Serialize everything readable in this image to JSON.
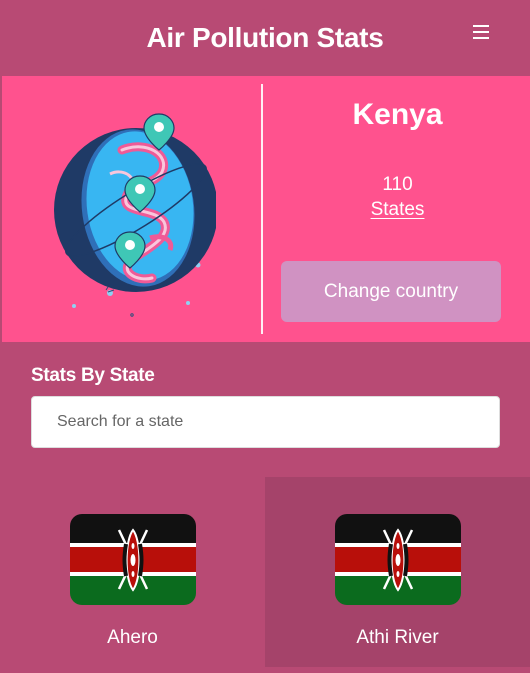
{
  "app": {
    "title": "Air Pollution Stats",
    "menu_icon": "hamburger-menu-icon"
  },
  "hero": {
    "illustration_icon": "globe-with-location-pins-icon",
    "country": "Kenya",
    "states_count": "110",
    "states_label": "States",
    "change_button": "Change country"
  },
  "stats_section": {
    "title": "Stats By State",
    "search_placeholder": "Search for a state",
    "search_value": ""
  },
  "states": [
    {
      "name": "Ahero",
      "flag_icon": "kenya-flag-icon"
    },
    {
      "name": "Athi River",
      "flag_icon": "kenya-flag-icon"
    }
  ],
  "colors": {
    "header": "#b84a74",
    "hero": "#ff528e",
    "button": "#d092c2",
    "card_alt": "#a5436a"
  }
}
